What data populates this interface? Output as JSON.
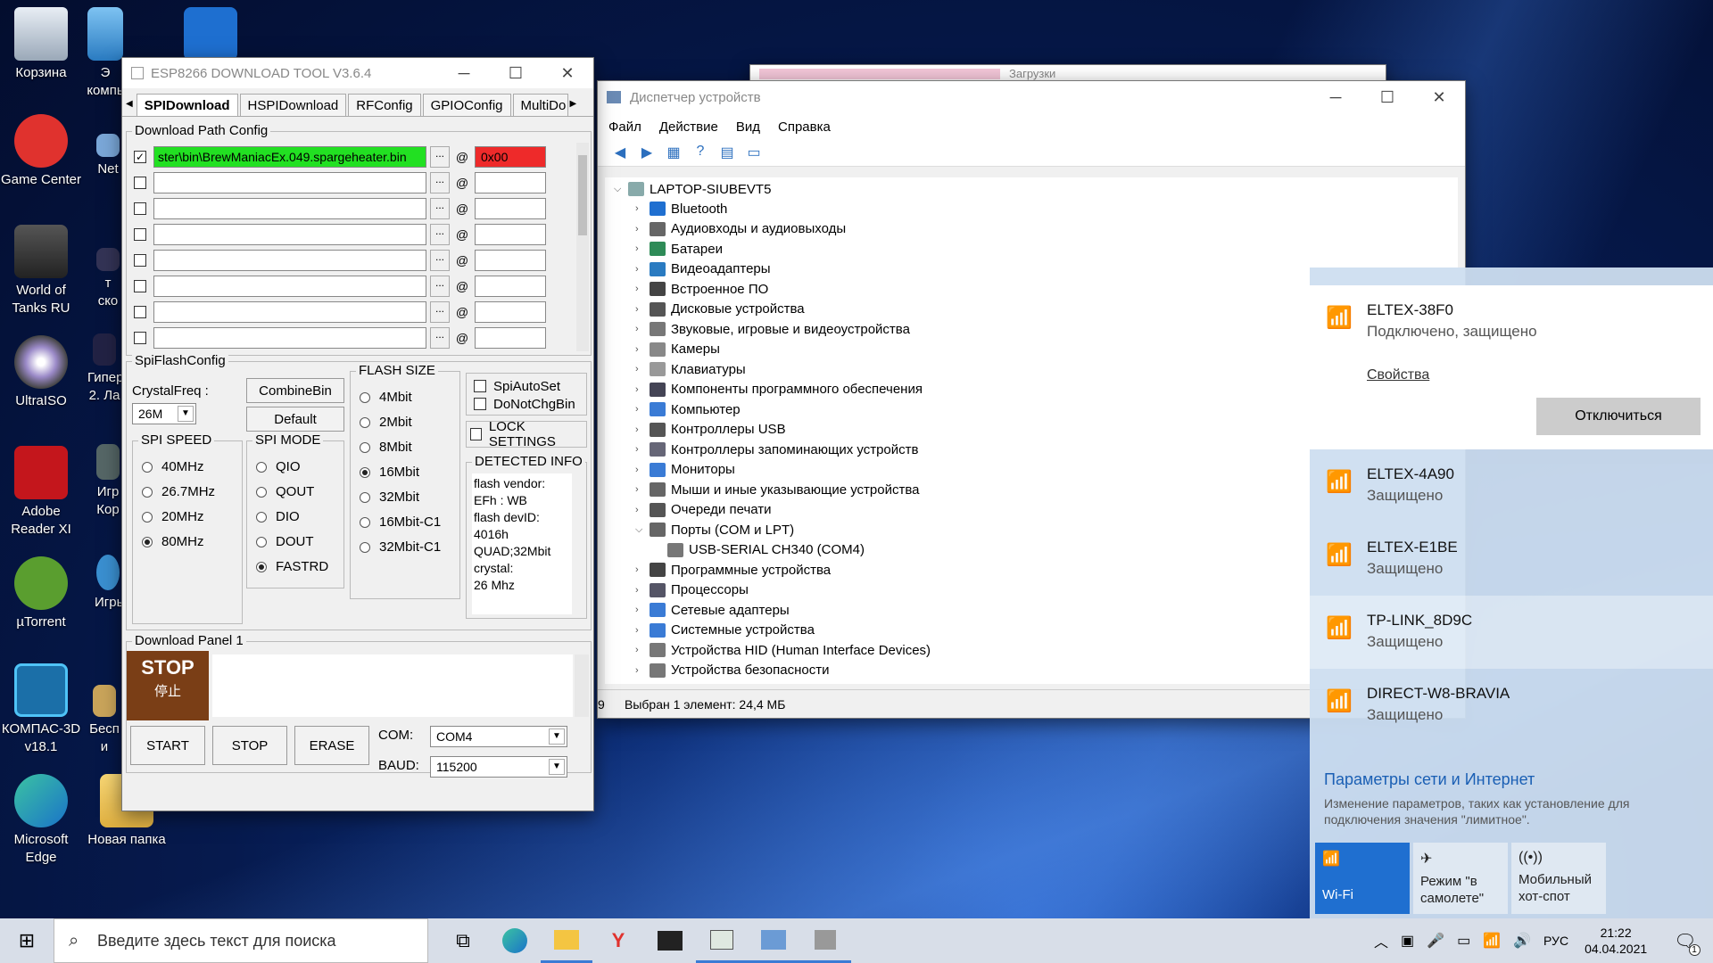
{
  "desktop_icons": [
    {
      "label": "Корзина"
    },
    {
      "label": "Game Center"
    },
    {
      "label": "World of Tanks RU"
    },
    {
      "label": "UltraISO"
    },
    {
      "label": "Adobe Reader XI"
    },
    {
      "label": "µTorrent"
    },
    {
      "label": "КОМПАС-3D v18.1"
    },
    {
      "label": "Microsoft Edge"
    },
    {
      "label": "Новая папка"
    },
    {
      "label": "Э компь"
    },
    {
      "label": "Net"
    },
    {
      "label": "т ско"
    },
    {
      "label": "Гипер 2. Ла"
    },
    {
      "label": "Игр Кор"
    },
    {
      "label": "Игры"
    },
    {
      "label": "Бесп и"
    }
  ],
  "esp": {
    "title": "ESP8266 DOWNLOAD TOOL V3.6.4",
    "tabs": [
      "SPIDownload",
      "HSPIDownload",
      "RFConfig",
      "GPIOConfig",
      "MultiDo"
    ],
    "download_path_config": "Download Path Config",
    "path1": "ster\\bin\\BrewManiacEx.049.spargeheater.bin",
    "addr1": "0x00",
    "dots": "...",
    "at": "@",
    "spiflashconfig": "SpiFlashConfig",
    "crystalfreq_label": "CrystalFreq :",
    "crystalfreq_value": "26M",
    "combinebin": "CombineBin",
    "default": "Default",
    "spi_speed_label": "SPI SPEED",
    "spi_speed": [
      "40MHz",
      "26.7MHz",
      "20MHz",
      "80MHz"
    ],
    "spi_mode_label": "SPI MODE",
    "spi_mode": [
      "QIO",
      "QOUT",
      "DIO",
      "DOUT",
      "FASTRD"
    ],
    "flash_size_label": "FLASH SIZE",
    "flash_size": [
      "4Mbit",
      "2Mbit",
      "8Mbit",
      "16Mbit",
      "32Mbit",
      "16Mbit-C1",
      "32Mbit-C1"
    ],
    "spiautoset": "SpiAutoSet",
    "donotchgbin": "DoNotChgBin",
    "lock_settings": "LOCK SETTINGS",
    "detected_info_label": "DETECTED INFO",
    "detected_info": [
      "flash vendor:",
      "EFh : WB",
      "flash devID:",
      "4016h",
      "QUAD;32Mbit",
      "crystal:",
      "26 Mhz"
    ],
    "download_panel": "Download Panel 1",
    "stop_big": "STOP",
    "stop_cn": "停止",
    "start": "START",
    "stop": "STOP",
    "erase": "ERASE",
    "com_label": "COM:",
    "com_value": "COM4",
    "baud_label": "BAUD:",
    "baud_value": "115200"
  },
  "devmgr": {
    "title": "Диспетчер устройств",
    "menu": [
      "Файл",
      "Действие",
      "Вид",
      "Справка"
    ],
    "root": "LAPTOP-SIUBEVT5",
    "items": [
      "Bluetooth",
      "Аудиовходы и аудиовыходы",
      "Батареи",
      "Видеоадаптеры",
      "Встроенное ПО",
      "Дисковые устройства",
      "Звуковые, игровые и видеоустройства",
      "Камеры",
      "Клавиатуры",
      "Компоненты программного обеспечения",
      "Компьютер",
      "Контроллеры USB",
      "Контроллеры запоминающих устройств",
      "Мониторы",
      "Мыши и иные указывающие устройства",
      "Очереди печати",
      "Порты (COM и LPT)",
      "USB-SERIAL CH340 (COM4)",
      "Программные устройства",
      "Процессоры",
      "Сетевые адаптеры",
      "Системные устройства",
      "Устройства HID (Human Interface Devices)",
      "Устройства безопасности"
    ],
    "status_left": "9",
    "status": "Выбран 1 элемент: 24,4 МБ"
  },
  "bg_window_title": "Загрузки",
  "wifi": {
    "networks": [
      {
        "name": "ELTEX-38F0",
        "status": "Подключено, защищено"
      },
      {
        "name": "ELTEX-4A90",
        "status": "Защищено"
      },
      {
        "name": "ELTEX-E1BE",
        "status": "Защищено"
      },
      {
        "name": "TP-LINK_8D9C",
        "status": "Защищено"
      },
      {
        "name": "DIRECT-W8-BRAVIA",
        "status": "Защищено"
      }
    ],
    "properties": "Свойства",
    "disconnect": "Отключиться",
    "settings_title": "Параметры сети и Интернет",
    "settings_desc": "Изменение параметров, таких как установление для подключения значения \"лимитное\".",
    "qa": [
      "Wi-Fi",
      "Режим \"в самолете\"",
      "Мобильный хот-спот"
    ]
  },
  "taskbar": {
    "search_placeholder": "Введите здесь текст для поиска",
    "lang": "РУС",
    "time": "21:22",
    "date": "04.04.2021",
    "notif_count": "1"
  }
}
